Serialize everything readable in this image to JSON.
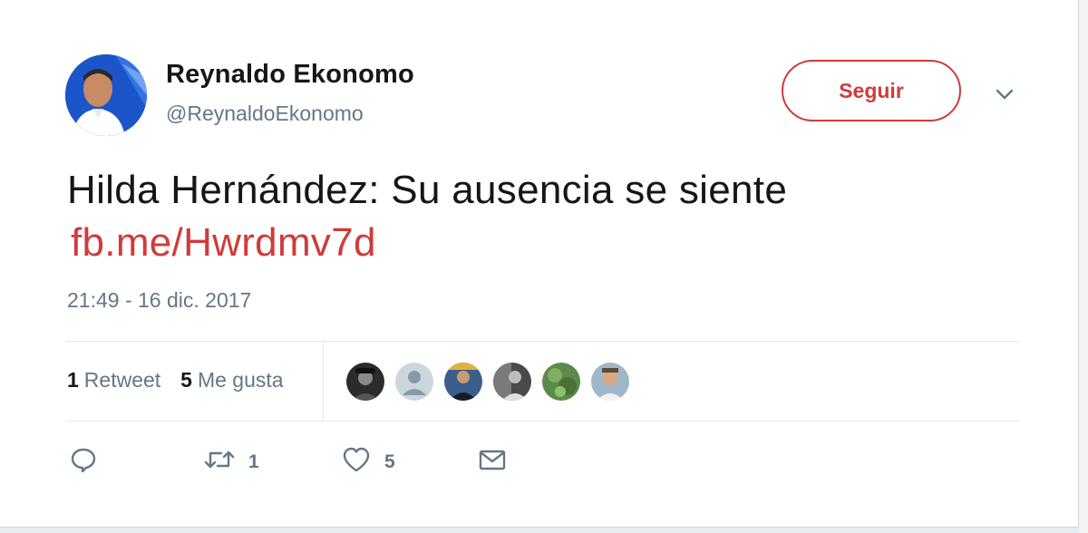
{
  "user": {
    "name": "Reynaldo Ekonomo",
    "handle": "@ReynaldoEkonomo"
  },
  "follow_button": {
    "label": "Seguir"
  },
  "tweet": {
    "text": "Hilda Hernández: Su ausencia se siente",
    "link": "fb.me/Hwrdmv7d",
    "timestamp": "21:49 - 16 dic. 2017"
  },
  "stats": {
    "retweets_count": "1",
    "retweets_label": "Retweet",
    "likes_count": "5",
    "likes_label": "Me gusta"
  },
  "actions": {
    "retweet_count": "1",
    "like_count": "5"
  },
  "colors": {
    "accent": "#d03b3b",
    "secondary_text": "#657786",
    "primary_text": "#14171a"
  }
}
